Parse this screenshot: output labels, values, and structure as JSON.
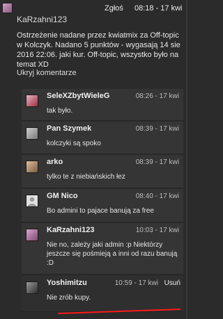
{
  "main_post": {
    "author": "KaRzahni123",
    "report_label": "Zgłoś",
    "time": "08:18 - 17 kwi",
    "warning_text": "Ostrzeżenie nadane przez kwiatmix za Off-topic w Kolczyk. Nadano 5 punktów - wygasają 14 sie 2016 22:06. jaki kur. Off-topic, wszystko było na temat XD",
    "hide_comments": "Ukryj komentarze"
  },
  "comments": [
    {
      "author": "SeleXZbytWieleG",
      "time": "08:26 - 17 kwi",
      "text": "tak było.",
      "avatar_color": "#b04a5e"
    },
    {
      "author": "Pan Szymek",
      "time": "08:39 - 17 kwi",
      "text": "kolczyki są spoko",
      "avatar_color": "#8a8a8a"
    },
    {
      "author": "arko",
      "time": "08:39 - 17 kwi",
      "text": "tylko te z niebiańskich łez",
      "avatar_color": "#9c7b5e"
    },
    {
      "author": "GM Nico",
      "time": "08:40 - 17 kwi",
      "text": "Bo admini to pajace banują za free",
      "avatar_color": "#d8d8d8"
    },
    {
      "author": "KaRzahni123",
      "time": "10:03 - 17 kwi",
      "text": "Nie no, zależy jaki admin :p Niektórzy jeszcze się pośmieją a inni od razu banują :D",
      "avatar_color": "#b67aa8"
    },
    {
      "author": "Yoshimitzu",
      "time": "10:59 - 17 kwi",
      "text": "Nie zrób kupy.",
      "delete_label": "Usuń",
      "avatar_color": "#6b6b6b"
    }
  ],
  "colors": {
    "background": "#2b2b2b",
    "comment_bg": "#353535",
    "highlight_underline": "#ff1a1a"
  }
}
